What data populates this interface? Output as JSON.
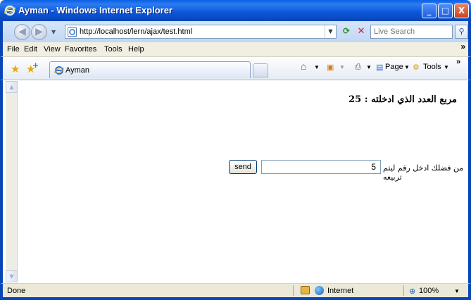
{
  "window": {
    "title": "Ayman - Windows Internet Explorer",
    "min_label": "_",
    "max_label": "□",
    "close_label": "X"
  },
  "address": {
    "url": "http://localhost/lern/ajax/test.html",
    "search_placeholder": "Live Search"
  },
  "menu": {
    "items": [
      "File",
      "Edit",
      "View",
      "Favorites",
      "Tools",
      "Help"
    ],
    "overflow": "»"
  },
  "tabs": {
    "active_label": "Ayman"
  },
  "commands": {
    "page_label": "Page",
    "tools_label": "Tools",
    "overflow": "»"
  },
  "page": {
    "result_text": "مربع العدد الذي ادخلته : 25",
    "prompt_text": "من فضلك ادخل رقم ليتم تربيعه",
    "input_value": "5",
    "send_label": "send"
  },
  "status": {
    "text": "Done",
    "zone": "Internet",
    "zoom": "100%"
  },
  "colors": {
    "titlebar": "#0846b8",
    "chrome": "#c3d7f4",
    "menubar": "#f1efe2"
  }
}
